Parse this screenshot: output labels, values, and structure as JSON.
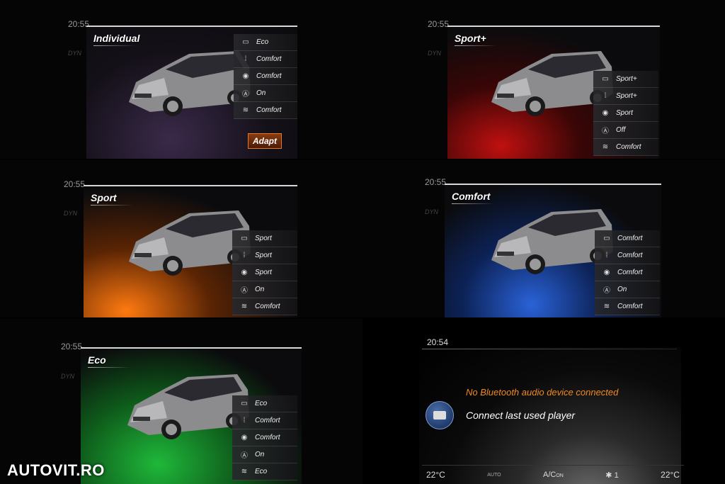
{
  "tiles": [
    {
      "time": "20:55",
      "title": "Individual",
      "glow": "#6a4a8a",
      "settings": [
        {
          "icon": "engine-icon",
          "glyph": "▭",
          "label": "Eco"
        },
        {
          "icon": "suspension-icon",
          "glyph": "⁞",
          "label": "Comfort"
        },
        {
          "icon": "steering-wheel-icon",
          "glyph": "◉",
          "label": "Comfort"
        },
        {
          "icon": "auto-start-stop-icon",
          "glyph": "Ⓐ",
          "label": "On"
        },
        {
          "icon": "climate-icon",
          "glyph": "≋",
          "label": "Comfort"
        }
      ],
      "button": "Adapt"
    },
    {
      "time": "20:55",
      "title": "Sport+",
      "glow": "#e01010",
      "settings": [
        {
          "icon": "engine-icon",
          "glyph": "▭",
          "label": "Sport+"
        },
        {
          "icon": "suspension-icon",
          "glyph": "⁞",
          "label": "Sport+"
        },
        {
          "icon": "steering-wheel-icon",
          "glyph": "◉",
          "label": "Sport"
        },
        {
          "icon": "auto-start-stop-icon",
          "glyph": "Ⓐ",
          "label": "Off"
        },
        {
          "icon": "climate-icon",
          "glyph": "≋",
          "label": "Comfort"
        }
      ]
    },
    {
      "time": "20:55",
      "title": "Sport",
      "glow": "#ff7a10",
      "settings": [
        {
          "icon": "engine-icon",
          "glyph": "▭",
          "label": "Sport"
        },
        {
          "icon": "suspension-icon",
          "glyph": "⁞",
          "label": "Sport"
        },
        {
          "icon": "steering-wheel-icon",
          "glyph": "◉",
          "label": "Sport"
        },
        {
          "icon": "auto-start-stop-icon",
          "glyph": "Ⓐ",
          "label": "On"
        },
        {
          "icon": "climate-icon",
          "glyph": "≋",
          "label": "Comfort"
        }
      ]
    },
    {
      "time": "20:55",
      "title": "Comfort",
      "glow": "#2a62d8",
      "settings": [
        {
          "icon": "engine-icon",
          "glyph": "▭",
          "label": "Comfort"
        },
        {
          "icon": "suspension-icon",
          "glyph": "⁞",
          "label": "Comfort"
        },
        {
          "icon": "steering-wheel-icon",
          "glyph": "◉",
          "label": "Comfort"
        },
        {
          "icon": "auto-start-stop-icon",
          "glyph": "Ⓐ",
          "label": "On"
        },
        {
          "icon": "climate-icon",
          "glyph": "≋",
          "label": "Comfort"
        }
      ]
    },
    {
      "time": "20:55",
      "title": "Eco",
      "glow": "#1fb83a",
      "settings": [
        {
          "icon": "engine-icon",
          "glyph": "▭",
          "label": "Eco"
        },
        {
          "icon": "suspension-icon",
          "glyph": "⁞",
          "label": "Comfort"
        },
        {
          "icon": "steering-wheel-icon",
          "glyph": "◉",
          "label": "Comfort"
        },
        {
          "icon": "auto-start-stop-icon",
          "glyph": "Ⓐ",
          "label": "On"
        },
        {
          "icon": "climate-icon",
          "glyph": "≋",
          "label": "Eco"
        }
      ]
    }
  ],
  "bluetooth": {
    "time": "20:54",
    "message": "No Bluetooth audio device connected",
    "connect_label": "Connect last used player",
    "temp_left": "22°C",
    "auto_label": "AUTO",
    "ac_label": "A/C",
    "ac_state": "ON",
    "fan_level": "1",
    "temp_right": "22°C"
  },
  "watermark": "AUTOVIT.RO"
}
